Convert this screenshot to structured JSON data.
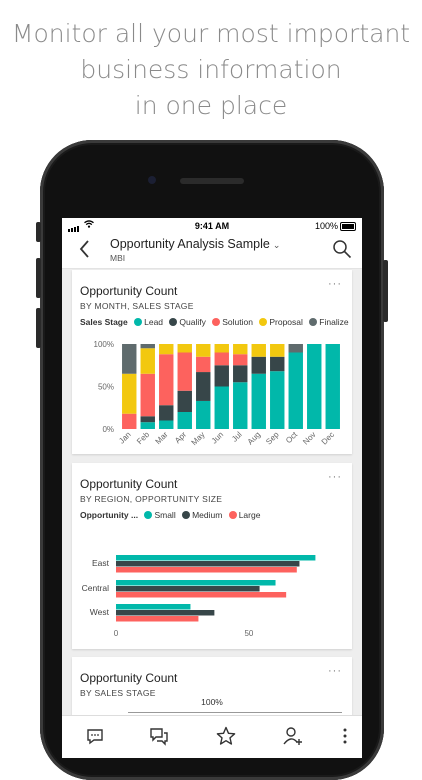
{
  "headline": {
    "line1": "Monitor all your most important",
    "line2": "business information",
    "line3": "in one place"
  },
  "status": {
    "time": "9:41 AM",
    "battery": "100%"
  },
  "nav": {
    "title": "Opportunity Analysis Sample",
    "subtitle": "MBI",
    "icons": [
      "back-arrow-icon",
      "search-icon"
    ]
  },
  "colors": {
    "Lead": "#01b8aa",
    "Qualify": "#374649",
    "Solution": "#fd625e",
    "Proposal": "#f2c80f",
    "Finalize": "#5f6b6d"
  },
  "cards": [
    {
      "title": "Opportunity Count",
      "subtitle": "BY MONTH, SALES STAGE",
      "more": "···",
      "legend_title": "Sales Stage",
      "legend": [
        "Lead",
        "Qualify",
        "Solution",
        "Proposal",
        "Finalize"
      ]
    },
    {
      "title": "Opportunity Count",
      "subtitle": "BY REGION, OPPORTUNITY SIZE",
      "more": "···",
      "legend_title": "Opportunity ...",
      "legend": [
        "Small",
        "Medium",
        "Large"
      ]
    },
    {
      "title": "Opportunity Count",
      "subtitle": "BY SALES STAGE",
      "more": "···"
    }
  ],
  "chart_data": [
    {
      "type": "bar",
      "stacked": "100%",
      "title": "Opportunity Count",
      "subtitle": "BY MONTH, SALES STAGE",
      "categories": [
        "Jan",
        "Feb",
        "Mar",
        "Apr",
        "May",
        "Jun",
        "Jul",
        "Aug",
        "Sep",
        "Oct",
        "Nov",
        "Dec"
      ],
      "ytick_labels": [
        "100%",
        "50%",
        "0%"
      ],
      "ylim": [
        0,
        100
      ],
      "series": [
        {
          "name": "Lead",
          "values": [
            0,
            8,
            10,
            20,
            33,
            50,
            55,
            65,
            68,
            90,
            100,
            100
          ]
        },
        {
          "name": "Qualify",
          "values": [
            0,
            7,
            18,
            25,
            34,
            25,
            20,
            20,
            17,
            0,
            0,
            0
          ]
        },
        {
          "name": "Solution",
          "values": [
            18,
            50,
            60,
            45,
            18,
            15,
            13,
            0,
            0,
            0,
            0,
            0
          ]
        },
        {
          "name": "Proposal",
          "values": [
            47,
            30,
            12,
            10,
            15,
            10,
            12,
            15,
            15,
            0,
            0,
            0
          ]
        },
        {
          "name": "Finalize",
          "values": [
            35,
            5,
            0,
            0,
            0,
            0,
            0,
            0,
            0,
            10,
            0,
            0
          ]
        }
      ]
    },
    {
      "type": "bar",
      "orientation": "horizontal",
      "title": "Opportunity Count",
      "subtitle": "BY REGION, OPPORTUNITY SIZE",
      "categories": [
        "East",
        "Central",
        "West"
      ],
      "xtick_labels": [
        "0",
        "50"
      ],
      "xlim": [
        0,
        85
      ],
      "series": [
        {
          "name": "Small",
          "color": "#01b8aa",
          "values": [
            75,
            60,
            28
          ]
        },
        {
          "name": "Medium",
          "color": "#374649",
          "values": [
            69,
            54,
            37
          ]
        },
        {
          "name": "Large",
          "color": "#fd625e",
          "values": [
            68,
            64,
            31
          ]
        }
      ]
    },
    {
      "type": "bar",
      "title": "Opportunity Count",
      "subtitle": "BY SALES STAGE",
      "value_labels": [
        "100%"
      ]
    }
  ],
  "bottom_tabs": [
    "chat-icon",
    "comments-icon",
    "favorites-star-icon",
    "add-person-icon",
    "more-vertical-icon"
  ]
}
